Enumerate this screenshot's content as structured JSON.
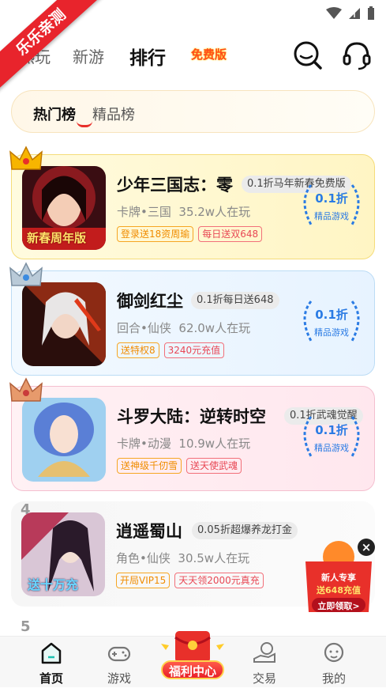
{
  "status_bar": {
    "icons": [
      "wifi-icon",
      "signal-icon",
      "battery-icon"
    ]
  },
  "ribbon": {
    "text": "乐乐亲测"
  },
  "top_nav": {
    "tabs": [
      {
        "label": "热玩",
        "active": false
      },
      {
        "label": "新游",
        "active": false
      },
      {
        "label": "排行",
        "active": true
      }
    ],
    "special_tab": "免费版",
    "right_icons": [
      "search-icon",
      "headset-icon"
    ]
  },
  "sub_tabs": [
    {
      "label": "热门榜",
      "active": true
    },
    {
      "label": "精品榜",
      "active": false
    }
  ],
  "games": [
    {
      "rank": "1",
      "name": "少年三国志：零",
      "promo": "0.1折马年新春免费版",
      "category": "卡牌•三国",
      "players": "35.2w人在玩",
      "tags": [
        {
          "text": "登录送18资周瑜",
          "color": "orange"
        },
        {
          "text": "每日送双648",
          "color": "red"
        }
      ],
      "discount": "0.1折",
      "badge_label": "精品游戏",
      "crown": "gold",
      "cover_label": "新春周年版"
    },
    {
      "rank": "2",
      "name": "御剑红尘",
      "promo": "0.1折每日送648",
      "category": "回合•仙侠",
      "players": "62.0w人在玩",
      "tags": [
        {
          "text": "送特权8",
          "color": "orange"
        },
        {
          "text": "3240元充值",
          "color": "red"
        }
      ],
      "discount": "0.1折",
      "badge_label": "精品游戏",
      "crown": "silver"
    },
    {
      "rank": "3",
      "name": "斗罗大陆：逆转时空",
      "promo": "0.1折武魂觉醒",
      "category": "卡牌•动漫",
      "players": "10.9w人在玩",
      "tags": [
        {
          "text": "送神级千仞雪",
          "color": "orange"
        },
        {
          "text": "送天使武魂",
          "color": "red"
        }
      ],
      "discount": "0.1折",
      "badge_label": "精品游戏",
      "crown": "bronze"
    },
    {
      "rank": "4",
      "name": "逍遥蜀山",
      "promo": "0.05折超爆养龙打金",
      "category": "角色•仙侠",
      "players": "30.5w人在玩",
      "tags": [
        {
          "text": "开局VIP15",
          "color": "orange"
        },
        {
          "text": "天天领2000元真充",
          "color": "red"
        }
      ],
      "cover_label": "送十万充"
    }
  ],
  "next_rank": "5",
  "float_ad": {
    "line1": "新人专享",
    "line2": "送648充值",
    "button": "立即领取>"
  },
  "bottom_nav": [
    {
      "label": "首页",
      "icon": "home-icon",
      "active": true
    },
    {
      "label": "游戏",
      "icon": "gamepad-icon",
      "active": false
    },
    {
      "label": "福利中心",
      "icon": "red-envelope-icon",
      "active": false
    },
    {
      "label": "交易",
      "icon": "trade-icon",
      "active": false
    },
    {
      "label": "我的",
      "icon": "profile-icon",
      "active": false
    }
  ],
  "colors": {
    "accent_red": "#e8302a",
    "discount_blue": "#2a7be4",
    "tag_orange": "#f08c00",
    "tag_red": "#e84855"
  }
}
